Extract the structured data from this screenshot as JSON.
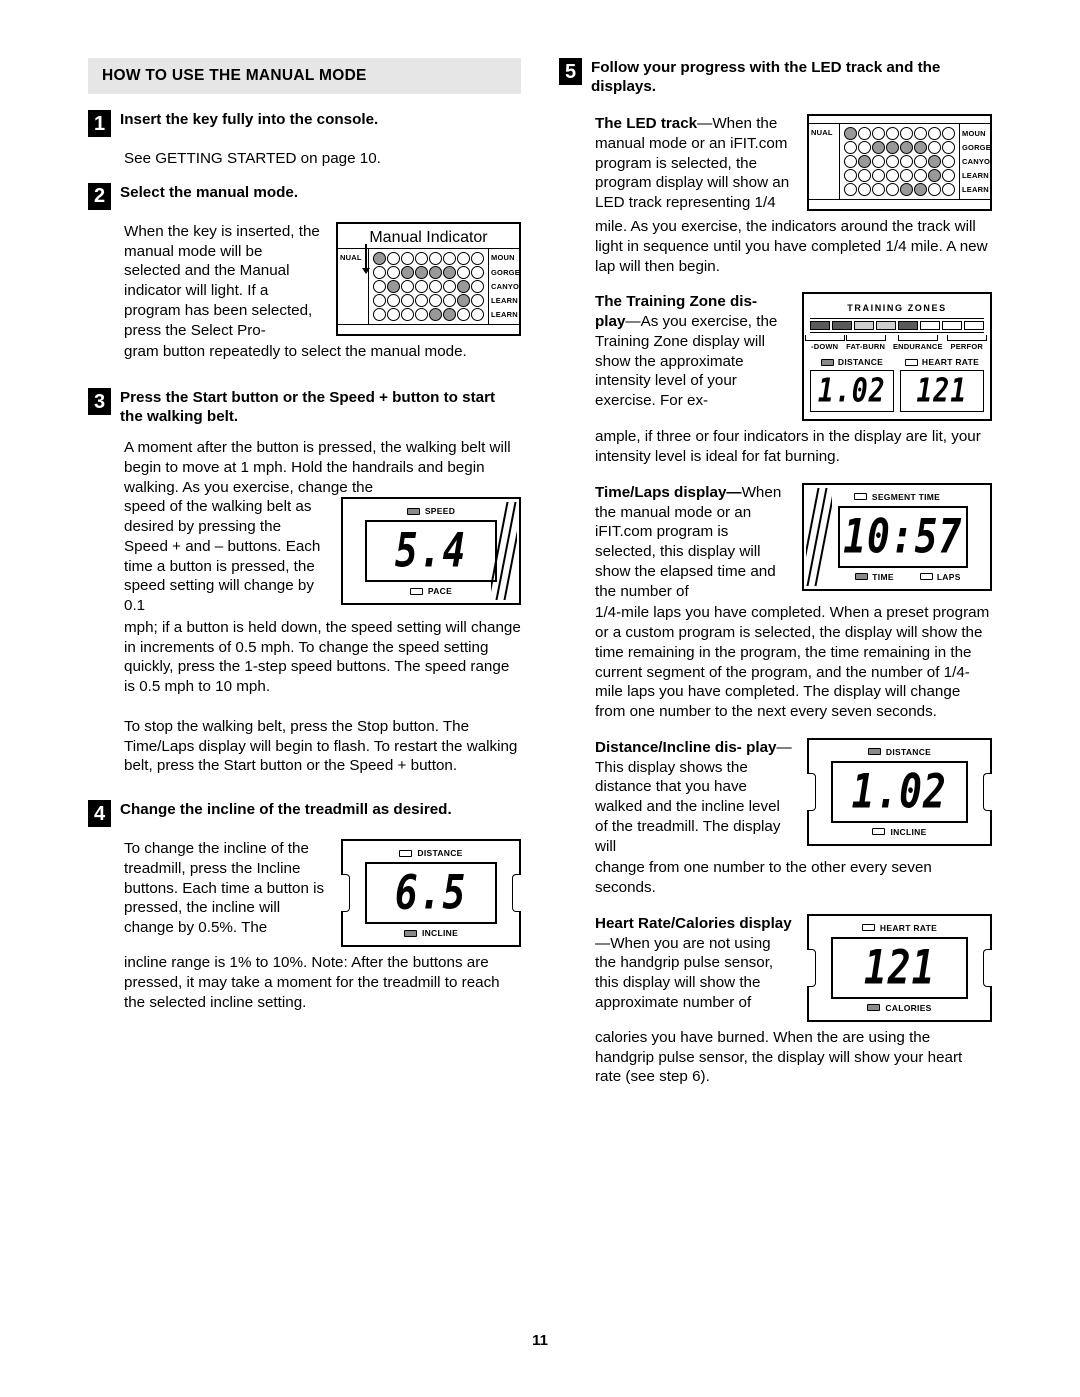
{
  "page": {
    "number": "11"
  },
  "left": {
    "section_header": "HOW TO USE THE MANUAL MODE",
    "steps": [
      {
        "num": "1",
        "title": "Insert the key fully into the console.",
        "body": "See GETTING STARTED on page 10."
      },
      {
        "num": "2",
        "title": "Select the manual mode.",
        "body_wrap": "When the key is inserted, the manual mode will be selected and the Manual indicator will light. If a program has been selected, press the Select Pro-",
        "body_tail": "gram button repeatedly to select the manual mode."
      },
      {
        "num": "3",
        "title": "Press the Start button or the Speed + button to start the walking belt.",
        "body_intro": "A moment after the button is pressed, the walking belt will begin to move at 1 mph. Hold the handrails and begin walking. As you exercise, change the",
        "body_wrap": "speed of the walking belt as desired by pressing the Speed + and – buttons. Each time a button is pressed, the speed setting will change by 0.1",
        "body_tail": "mph; if a button is held down, the speed setting will change in increments of 0.5 mph. To change the speed setting quickly, press the 1-step speed buttons. The speed range is 0.5 mph to 10 mph.",
        "body_para2": "To stop the walking belt, press the Stop button. The Time/Laps display will begin to flash. To restart the walking belt, press the Start button or the Speed + button."
      },
      {
        "num": "4",
        "title": "Change the incline of the treadmill as desired.",
        "body_wrap": "To change the incline of the treadmill, press the Incline buttons. Each time a button is pressed, the incline will change by 0.5%. The",
        "body_tail": "incline range is 1% to 10%. Note: After the buttons are pressed, it may take a moment for the treadmill to reach the selected incline setting."
      }
    ],
    "manual_indicator_figure": {
      "caption": "Manual Indicator",
      "left_label": "NUAL",
      "right_labels": [
        "MOUN",
        "GORGE",
        "CANYO",
        "LEARN",
        "LEARN"
      ]
    },
    "speed_display": {
      "top_label": "SPEED",
      "top_label_on": true,
      "value": "5.4",
      "bottom_label": "PACE",
      "bottom_label_on": false
    },
    "incline_display": {
      "top_label": "DISTANCE",
      "top_label_on": false,
      "value": "6.5",
      "bottom_label": "INCLINE",
      "bottom_label_on": true
    }
  },
  "right": {
    "step": {
      "num": "5",
      "title": "Follow your progress with the LED track and the displays."
    },
    "led_track": {
      "lead_in": "The LED track",
      "wrap_text": "—When the manual mode or an iFIT.com program is selected, the program display will show an LED track representing 1/4",
      "tail_text": "mile. As you exercise, the indicators around the track will light in sequence until you have completed 1/4 mile. A new lap will then begin.",
      "left_label": "NUAL",
      "right_labels": [
        "MOUN",
        "GORGE",
        "CANYO",
        "LEARN",
        "LEARN"
      ]
    },
    "training_zone": {
      "lead_in": "The Training Zone dis-",
      "lead_in2": "play",
      "wrap_text": "—As you exercise, the Training Zone display will show the approximate intensity level of your exercise. For ex-",
      "tail_text": "ample, if three or four indicators in the display are lit, your intensity level is ideal for fat burning.",
      "figure": {
        "title": "TRAINING ZONES",
        "zones": [
          "-DOWN",
          "FAT-BURN",
          "ENDURANCE",
          "PERFOR"
        ],
        "left_label": "DISTANCE",
        "left_label_on": true,
        "left_value": "1.02",
        "right_label": "HEART RATE",
        "right_label_on": false,
        "right_value": "121"
      }
    },
    "time_laps": {
      "lead_in": "Time/Laps display—",
      "wrap_text": "When the manual mode or an iFIT.com program is selected, this display will show the elapsed time and the number of",
      "tail_text": "1/4-mile laps you have completed. When a preset program or a custom program is selected, the display will show the time remaining in the program, the time remaining in the current segment of the program, and the number of 1/4-mile laps you have completed. The display will change from one number to the next every seven seconds.",
      "figure": {
        "top_label": "SEGMENT TIME",
        "top_label_on": false,
        "value": "10:57",
        "bottom_label_1": "TIME",
        "bottom_label_1_on": true,
        "bottom_label_2": "LAPS",
        "bottom_label_2_on": false
      }
    },
    "distance_incline": {
      "lead_in": "Distance/Incline dis-",
      "lead_in2": "play",
      "wrap_text": "—This display shows the distance that you have walked and the incline level of the treadmill. The display will",
      "tail_text": "change from one number to the other every seven seconds.",
      "figure": {
        "top_label": "DISTANCE",
        "top_label_on": true,
        "value": "1.02",
        "bottom_label": "INCLINE",
        "bottom_label_on": false
      }
    },
    "heart_rate_calories": {
      "lead_in": "Heart Rate/Calories",
      "lead_in2": "display",
      "wrap_text": "—When you are not using the handgrip pulse sensor, this display will show the approximate number of",
      "tail_text": "calories you have burned. When the are using the handgrip pulse sensor, the display will show your heart rate (see step 6).",
      "figure": {
        "top_label": "HEART RATE",
        "top_label_on": false,
        "value": "121",
        "bottom_label": "CALORIES",
        "bottom_label_on": true
      }
    }
  },
  "led_pattern": {
    "rows": [
      [
        1,
        0,
        0,
        0,
        0,
        0,
        0,
        0
      ],
      [
        0,
        0,
        1,
        1,
        1,
        1,
        0,
        0
      ],
      [
        0,
        1,
        0,
        0,
        0,
        0,
        1,
        0
      ],
      [
        0,
        0,
        0,
        0,
        0,
        0,
        1,
        0
      ],
      [
        0,
        0,
        0,
        0,
        1,
        1,
        0,
        0
      ]
    ]
  },
  "training_zone_segments": [
    1,
    1,
    2,
    2,
    1,
    0,
    0,
    0
  ]
}
